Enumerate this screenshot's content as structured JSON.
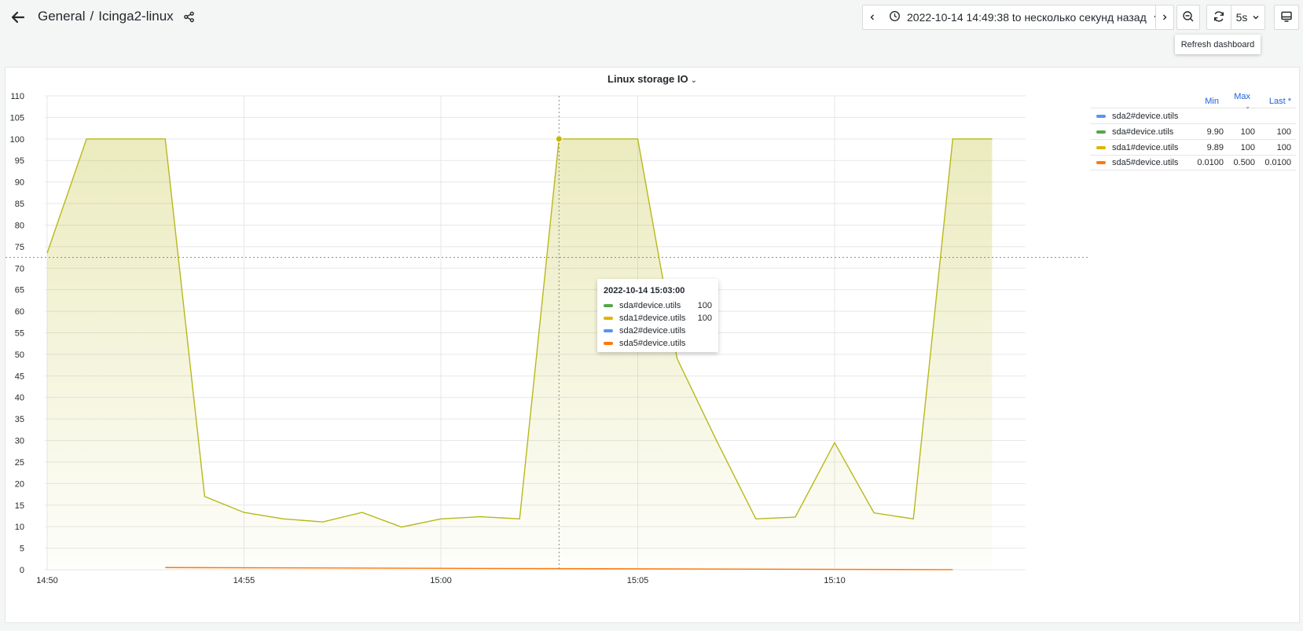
{
  "breadcrumb": {
    "folder": "General",
    "separator": "/",
    "dashboard": "Icinga2-linux"
  },
  "toolbar": {
    "time_range": "2022-10-14 14:49:38 to несколько секунд назад",
    "interval": "5s",
    "refresh_tooltip": "Refresh dashboard"
  },
  "colors": {
    "sda2": "#5794f2",
    "sda": "#56a64b",
    "sda1": "#e0b400",
    "sda5": "#ff780a",
    "sda1_line": "#b8b81a"
  },
  "icons": [
    "back-arrow-icon",
    "share-icon",
    "chevron-left-icon",
    "clock-icon",
    "chevron-down-icon",
    "chevron-right-icon",
    "zoom-out-icon",
    "refresh-icon",
    "tv-icon"
  ],
  "panel": {
    "title": "Linux storage IO"
  },
  "legend": {
    "headers": {
      "min": "Min",
      "max": "Max",
      "last": "Last *"
    },
    "rows": [
      {
        "name": "sda2#device.utils",
        "color": "#5794f2",
        "min": "",
        "max": "",
        "last": ""
      },
      {
        "name": "sda#device.utils",
        "color": "#56a64b",
        "min": "9.90",
        "max": "100",
        "last": "100"
      },
      {
        "name": "sda1#device.utils",
        "color": "#e0b400",
        "min": "9.89",
        "max": "100",
        "last": "100"
      },
      {
        "name": "sda5#device.utils",
        "color": "#ff780a",
        "min": "0.0100",
        "max": "0.500",
        "last": "0.0100"
      }
    ]
  },
  "hover_tooltip": {
    "time": "2022-10-14 15:03:00",
    "rows": [
      {
        "name": "sda#device.utils",
        "color": "#56a64b",
        "value": "100"
      },
      {
        "name": "sda1#device.utils",
        "color": "#e0b400",
        "value": "100"
      },
      {
        "name": "sda2#device.utils",
        "color": "#5794f2",
        "value": ""
      },
      {
        "name": "sda5#device.utils",
        "color": "#ff780a",
        "value": ""
      }
    ]
  },
  "chart_data": {
    "type": "line",
    "title": "Linux storage IO",
    "x_ticks": [
      "14:50",
      "14:55",
      "15:00",
      "15:05",
      "15:10"
    ],
    "y_ticks": [
      0,
      5,
      10,
      15,
      20,
      25,
      30,
      35,
      40,
      45,
      50,
      55,
      60,
      65,
      70,
      75,
      80,
      85,
      90,
      95,
      100,
      105,
      110
    ],
    "ylim": [
      0,
      110
    ],
    "xlim_minutes": [
      "14:50",
      "15:14"
    ],
    "grid": true,
    "legend_placement": "right",
    "series": [
      {
        "name": "sda1#device.utils",
        "color": "#b8b81a",
        "x": [
          "14:50",
          "14:51",
          "14:52",
          "14:53",
          "14:54",
          "14:55",
          "14:56",
          "14:57",
          "14:58",
          "14:59",
          "15:00",
          "15:01",
          "15:02",
          "15:03",
          "15:04",
          "15:05",
          "15:06",
          "15:07",
          "15:08",
          "15:09",
          "15:10",
          "15:11",
          "15:12",
          "15:13",
          "15:14"
        ],
        "values": [
          73.5,
          100,
          100,
          100,
          17,
          13.3,
          11.8,
          11.1,
          13.3,
          9.9,
          11.8,
          12.3,
          11.8,
          100,
          100,
          100,
          49,
          30,
          11.8,
          12.2,
          29.5,
          13.2,
          11.8,
          100,
          100
        ]
      },
      {
        "name": "sda5#device.utils",
        "color": "#ff780a",
        "x": [
          "14:53",
          "15:13"
        ],
        "values": [
          0.5,
          0.01
        ]
      }
    ],
    "hover_time": "15:03",
    "hover_value": 100,
    "crosshair_y": 72.5
  }
}
